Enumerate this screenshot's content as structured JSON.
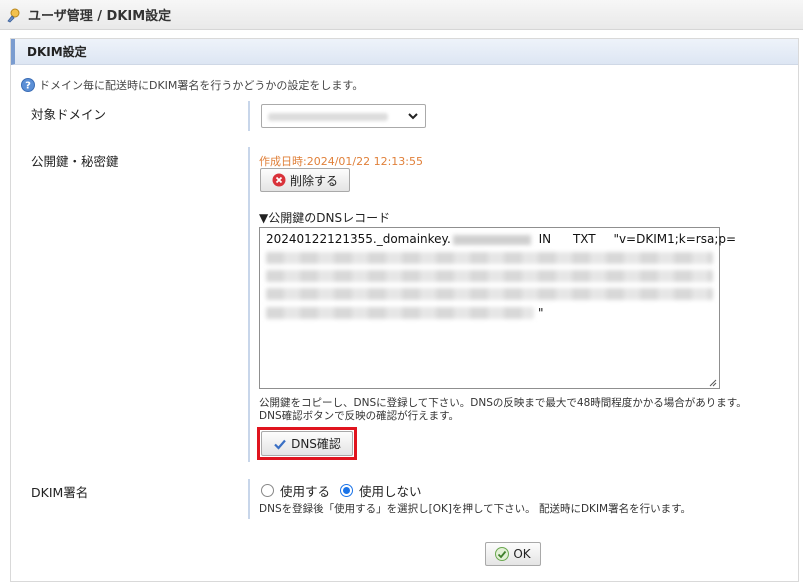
{
  "header": {
    "title": "ユーザ管理 / DKIM設定"
  },
  "panel": {
    "title": "DKIM設定",
    "info": "ドメイン毎に配送時にDKIM署名を行うかどうかの設定をします。"
  },
  "form": {
    "domain_label": "対象ドメイン",
    "keys_label": "公開鍵・秘密鍵",
    "created": "作成日時:2024/01/22 12:13:55",
    "delete_label": "削除する",
    "dns_record_title": "▼公開鍵のDNSレコード",
    "dns_record_prefix": "20240122121355._domainkey.",
    "dns_record_in": "IN",
    "dns_record_txt": "TXT",
    "dns_record_value_start": "\"v=DKIM1;k=rsa;p=",
    "dns_record_end": "\"",
    "note_line1": "公開鍵をコピーし、DNSに登録して下さい。DNSの反映まで最大で48時間程度かかる場合があります。",
    "note_line2": "DNS確認ボタンで反映の確認が行えます。",
    "dns_check_label": "DNS確認",
    "sign_label": "DKIM署名",
    "use_label": "使用する",
    "nouse_label": "使用しない",
    "sign_note": "DNSを登録後「使用する」を選択し[OK]を押して下さい。 配送時にDKIM署名を行います。",
    "ok_label": "OK"
  },
  "colors": {
    "accent": "#1a73e8",
    "highlight": "#e0141e",
    "created": "#e0803a"
  },
  "icons": [
    "user-admin-icon",
    "help-icon",
    "chevron-down-icon",
    "delete-icon",
    "check-icon",
    "ok-icon",
    "resize-grip-icon"
  ]
}
